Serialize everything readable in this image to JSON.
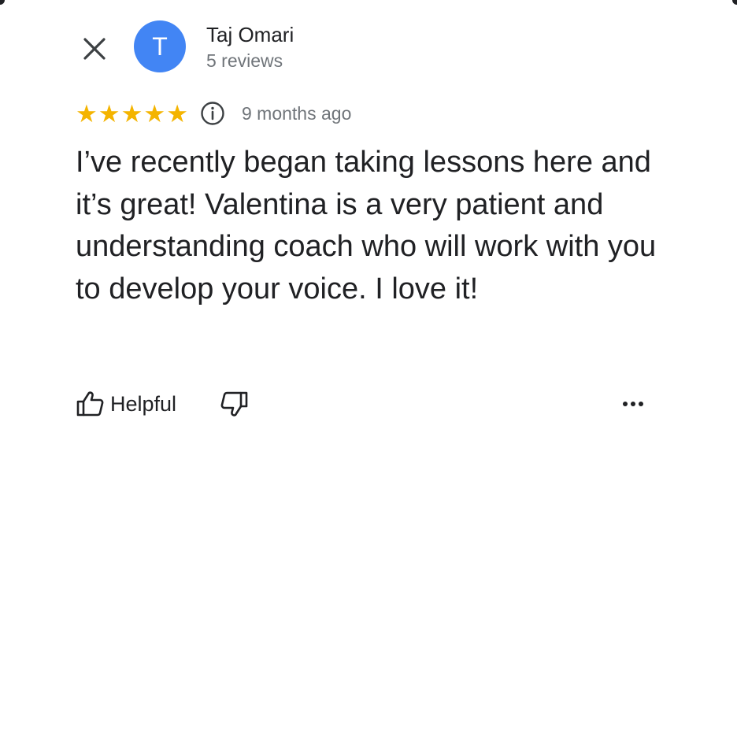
{
  "colors": {
    "star": "#f4b400",
    "avatar_bg": "#4285f4",
    "secondary_text": "#70757a",
    "primary_text": "#202124"
  },
  "header": {
    "close_icon": "close-icon",
    "avatar_initial": "T",
    "reviewer_name": "Taj Omari",
    "review_count": "5 reviews"
  },
  "rating": {
    "stars": 5,
    "max_stars": 5,
    "info_icon": "info-icon",
    "timestamp": "9 months ago"
  },
  "review": {
    "text": "I’ve recently began taking lessons here and it’s great! Valentina is a very patient and understanding coach who will work with you to develop your voice. I love it!"
  },
  "actions": {
    "helpful_icon": "thumb-up-icon",
    "helpful_label": "Helpful",
    "dislike_icon": "thumb-down-icon",
    "more_icon": "more-horizontal-icon"
  }
}
